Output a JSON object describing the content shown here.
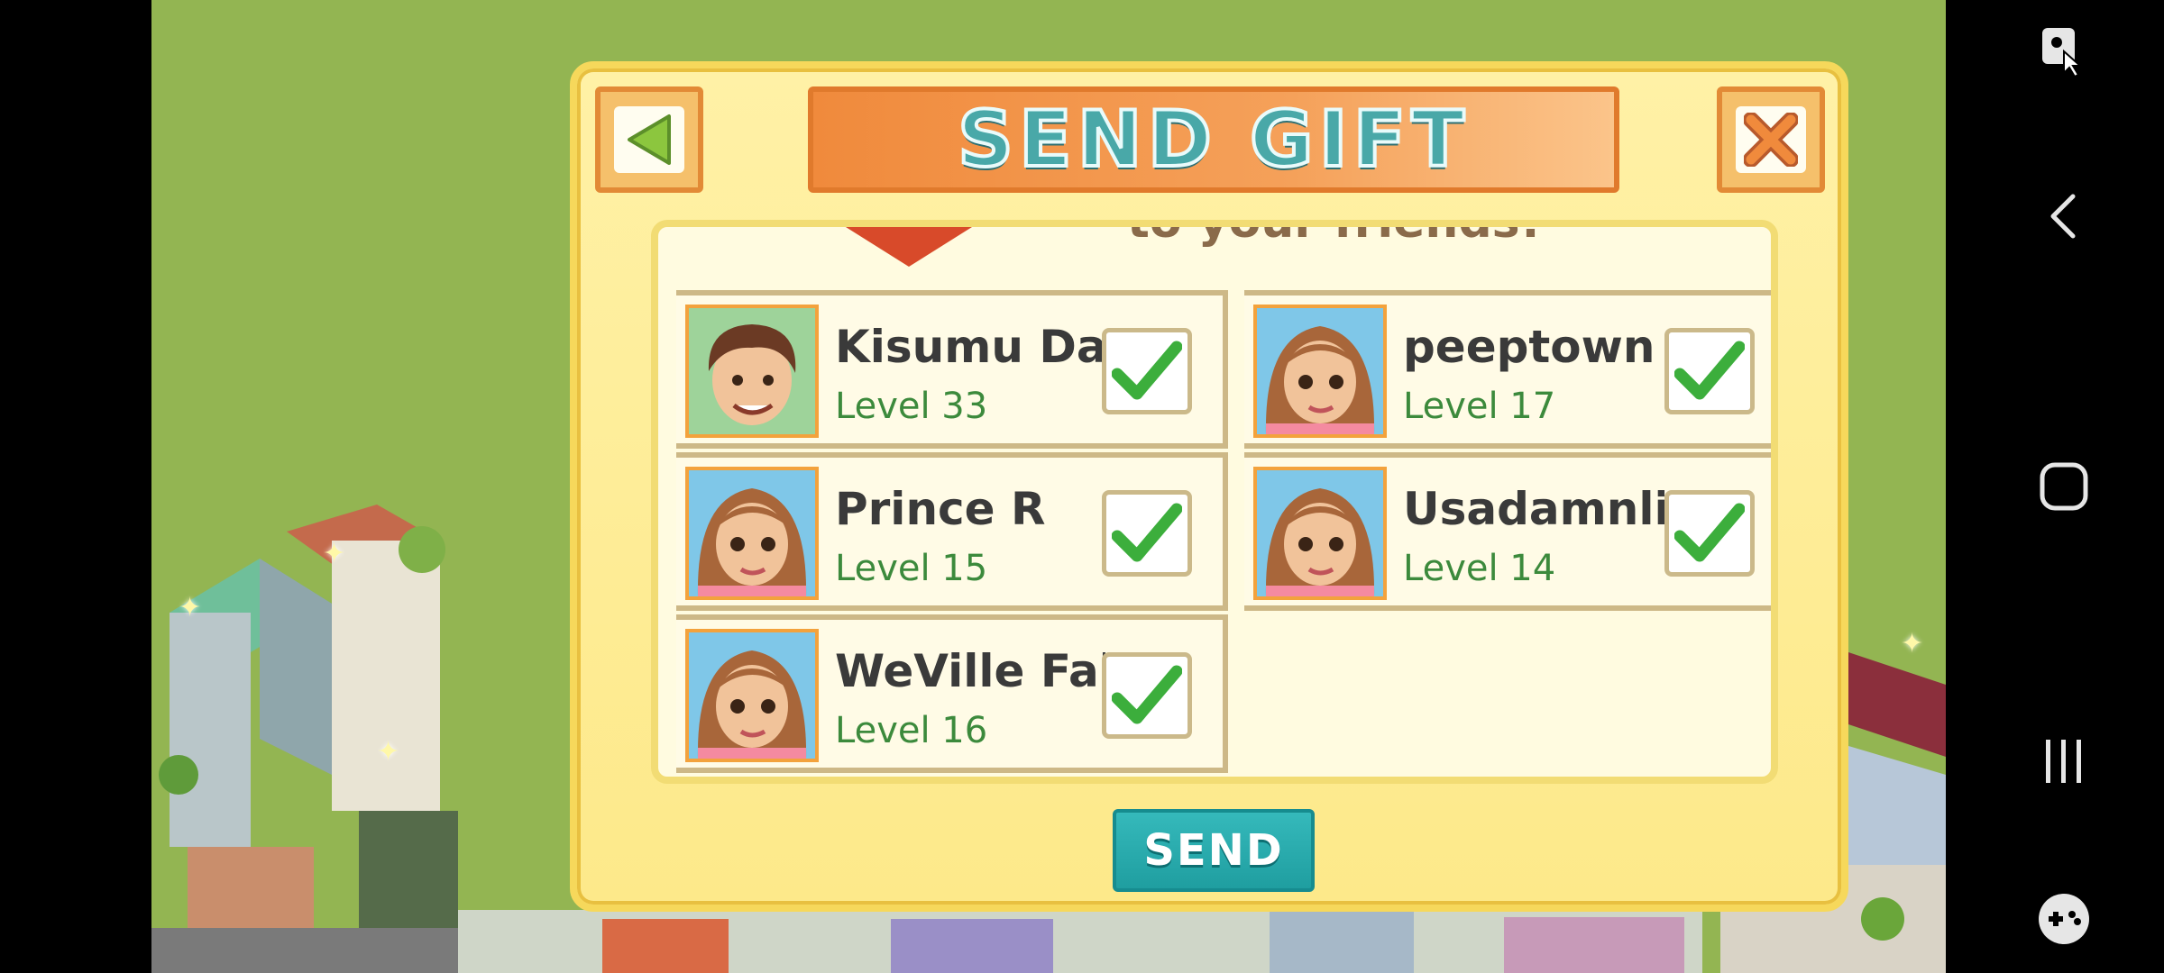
{
  "dialog": {
    "title": "SEND GIFT",
    "caption": "to your friends!",
    "send_label": "SEND",
    "back_icon": "triangle-left-icon",
    "close_label": "X"
  },
  "friends": [
    {
      "name": "Kisumu Dala",
      "level": "Level 33",
      "checked": true,
      "avatar": "boy-avatar"
    },
    {
      "name": "peeptown",
      "level": "Level 17",
      "checked": true,
      "avatar": "girl-avatar"
    },
    {
      "name": "Prince R",
      "level": "Level 15",
      "checked": true,
      "avatar": "girl-avatar"
    },
    {
      "name": "Usadamnlie",
      "level": "Level 14",
      "checked": true,
      "avatar": "girl-avatar"
    },
    {
      "name": "WeVille Falls",
      "level": "Level 16",
      "checked": true,
      "avatar": "girl-avatar"
    }
  ],
  "colors": {
    "accent_orange": "#f08a3c",
    "title_teal": "#49a8a8",
    "send_teal": "#1f9ea0",
    "check_green": "#3cae3c",
    "level_green": "#3c8a3c"
  },
  "navbar": {
    "icons": [
      "screenshot-tool-icon",
      "back-arrow-icon",
      "home-icon",
      "recent-apps-icon",
      "game-controller-icon"
    ]
  }
}
